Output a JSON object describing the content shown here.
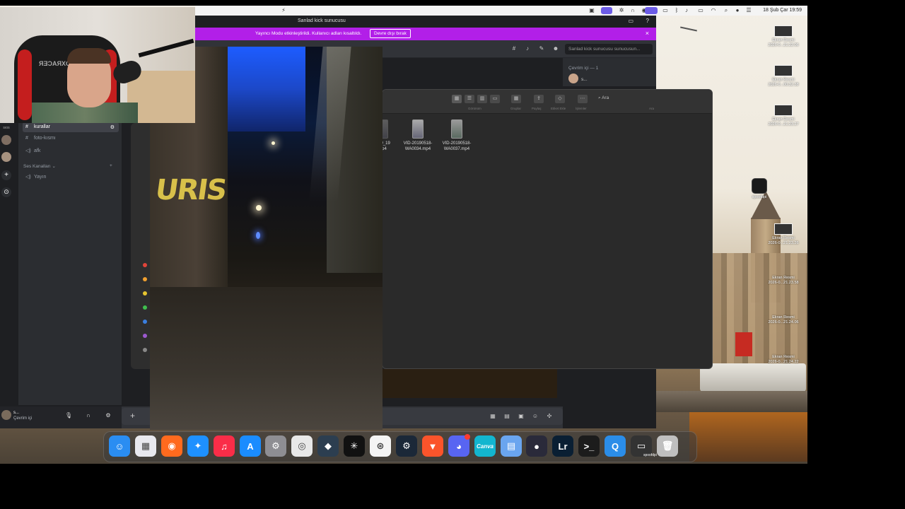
{
  "menubar": {
    "clock": "18 Şub Çar  19:59",
    "icons": [
      "cast-icon",
      "screen-icon",
      "gear-icon",
      "headphones-icon",
      "play-icon",
      "screen-share-icon",
      "bluetooth-icon",
      "music-icon",
      "display-icon",
      "wifi-icon",
      "search-icon",
      "siri-icon",
      "control-center-icon"
    ]
  },
  "discord": {
    "window_title": "Sanlad kick sunucusu",
    "streamer_notice": "Yayıncı Modu etkinleştirildi. Kullanıcı adları kısaltıldı.",
    "streamer_button": "Devre dışı bırak",
    "search_placeholder": "Sanlad kick sunucusu sunucusun...",
    "channels": [
      {
        "glyph": "#",
        "label": "kurallar"
      },
      {
        "glyph": "#",
        "label": "foto-kısmı"
      },
      {
        "glyph": "◁)",
        "label": "afk"
      }
    ],
    "voice_category": "Ses Kanalları",
    "voice_channels": [
      {
        "glyph": "◁)",
        "label": "Yayın"
      }
    ],
    "server_rail_label": "sıos",
    "members_header": "Çevrim içi — 1",
    "member_name": "s...",
    "user": {
      "name": "s...",
      "status": "Çevrim içi"
    }
  },
  "finder": {
    "toolbar_labels": [
      "Görünüm",
      "Gruplar",
      "Paylaş",
      "Etiket Ekle",
      "İşlemler",
      "Ara"
    ],
    "search": "Ara",
    "files": [
      {
        "name": "...19_19\n...p4",
        "partial": true
      },
      {
        "name": "VID-20190518-\nWA0034.mp4"
      },
      {
        "name": "VID-20190518-\nWA0037.mp4"
      }
    ],
    "tag_colors": [
      "#e0443a",
      "#f0a030",
      "#e6c530",
      "#3fbf4f",
      "#3a7fe0",
      "#9b59d0",
      "#888888"
    ]
  },
  "video": {
    "graffiti": "URIS"
  },
  "webcam": {
    "chair_brand": "DXRACER"
  },
  "desktop_icons": [
    {
      "name": "Ekran Resmi\n2026-0...21.22.06"
    },
    {
      "name": "Ekran Resmi\n2026-0...00.32.38"
    },
    {
      "name": "Ekran Resmi\n2026-0...21.23.27"
    },
    {
      "name": "spoofdpi"
    },
    {
      "name": "Ekran Resmi\n2026-0...21.23.26"
    },
    {
      "name": "Ekran Resmi\n2026-0...21.23.58"
    },
    {
      "name": "Ekran Resmi\n2026-0...21.24.06"
    },
    {
      "name": "Ekran Resmi\n2026-0...21.24.22"
    }
  ],
  "dock": {
    "apps": [
      {
        "name": "finder",
        "glyph": "☺",
        "color": "#2a8df2"
      },
      {
        "name": "launchpad",
        "glyph": "▦",
        "color": "#e8e8ee"
      },
      {
        "name": "firefox",
        "glyph": "◉",
        "color": "#ff6a1e"
      },
      {
        "name": "safari",
        "glyph": "✦",
        "color": "#1e90ff"
      },
      {
        "name": "music",
        "glyph": "♫",
        "color": "#fa2d48"
      },
      {
        "name": "app-store",
        "glyph": "A",
        "color": "#1a8cff"
      },
      {
        "name": "system-settings",
        "glyph": "⚙",
        "color": "#8e8e93"
      },
      {
        "name": "chrome",
        "glyph": "◎",
        "color": "#e8e8e8"
      },
      {
        "name": "davinci-resolve",
        "glyph": "◆",
        "color": "#2c3e50"
      },
      {
        "name": "perplexity",
        "glyph": "✳",
        "color": "#111111"
      },
      {
        "name": "chatgpt",
        "glyph": "⊛",
        "color": "#f4f4f4"
      },
      {
        "name": "steam",
        "glyph": "⚙",
        "color": "#1b2838"
      },
      {
        "name": "brave",
        "glyph": "▼",
        "color": "#fb542b"
      },
      {
        "name": "discord",
        "glyph": "◕",
        "color": "#5865f2"
      },
      {
        "name": "canva",
        "glyph": "Canva",
        "color": "#13b6cf"
      },
      {
        "name": "preview",
        "glyph": "▤",
        "color": "#6aa5ef"
      },
      {
        "name": "obs",
        "glyph": "●",
        "color": "#2a2a3a"
      },
      {
        "name": "lightroom",
        "glyph": "Lr",
        "color": "#0a1f33"
      },
      {
        "name": "terminal",
        "glyph": ">_",
        "color": "#1c1c1c"
      },
      {
        "name": "quicktime",
        "glyph": "Q",
        "color": "#2b8de8"
      },
      {
        "name": "spoofdpi-window",
        "glyph": "▭",
        "color": "#333333"
      },
      {
        "name": "trash",
        "glyph": "🗑",
        "color": "#bfbfbf"
      }
    ],
    "spoofdpi_label": "spoofdpi"
  }
}
